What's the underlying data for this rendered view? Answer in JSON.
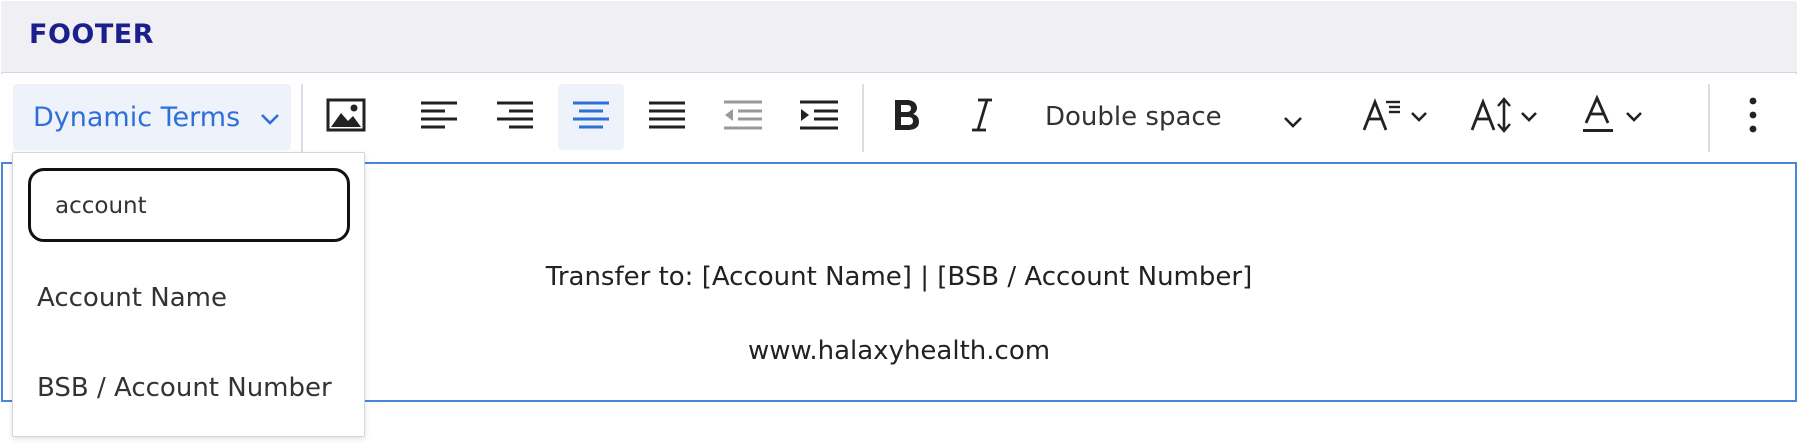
{
  "section": {
    "title": "FOOTER"
  },
  "toolbar": {
    "dynamic_terms_label": "Dynamic Terms",
    "line_spacing_value": "Double space",
    "active_alignment": "center",
    "accent_color": "#2f6fd8"
  },
  "dropdown": {
    "search_value": "account",
    "items": [
      "Account Name",
      "BSB / Account Number"
    ]
  },
  "editor": {
    "lines": [
      "Transfer to: [Account Name] | [BSB / Account Number]",
      "www.halaxyhealth.com"
    ]
  },
  "colors": {
    "header_bg": "#efeff4",
    "header_text": "#1a1f8c",
    "editor_border": "#4a86d8",
    "active_bg": "#eef3fb"
  }
}
